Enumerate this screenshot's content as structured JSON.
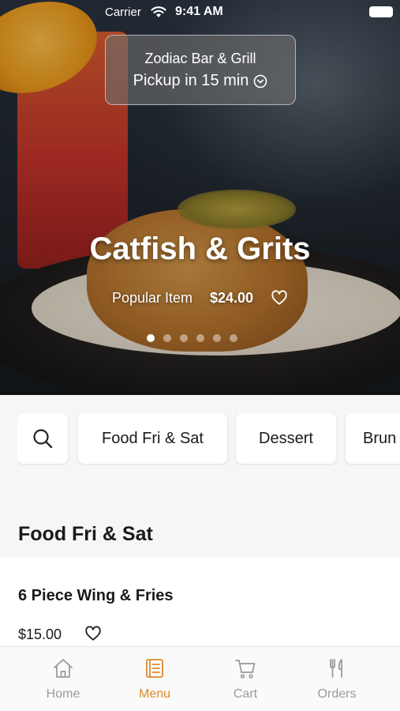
{
  "status_bar": {
    "carrier": "Carrier",
    "time": "9:41 AM"
  },
  "location": {
    "name": "Zodiac Bar & Grill",
    "pickup": "Pickup in 15 min"
  },
  "hero": {
    "title": "Catfish & Grits",
    "tag": "Popular Item",
    "price": "$24.00",
    "slides_total": 6,
    "slide_active": 1
  },
  "categories": [
    "Food Fri & Sat",
    "Dessert",
    "Brun"
  ],
  "section": {
    "title": "Food Fri & Sat",
    "items": [
      {
        "name": "6 Piece Wing & Fries",
        "price": "$15.00"
      }
    ]
  },
  "tabs": [
    {
      "label": "Home",
      "icon": "home-icon"
    },
    {
      "label": "Menu",
      "icon": "menu-icon"
    },
    {
      "label": "Cart",
      "icon": "cart-icon"
    },
    {
      "label": "Orders",
      "icon": "orders-icon"
    }
  ],
  "colors": {
    "accent": "#e0892a",
    "inactive": "#9a9a9a"
  }
}
